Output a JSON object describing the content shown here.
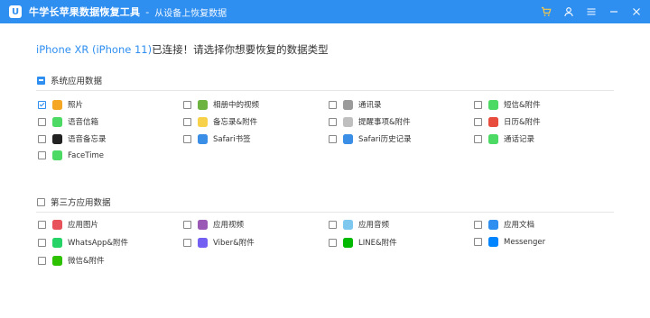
{
  "titlebar": {
    "app_name": "牛学长苹果数据恢复工具",
    "separator": "-",
    "breadcrumb": "从设备上恢复数据"
  },
  "headline": {
    "device": "iPhone XR (iPhone 11)",
    "text": "已连接！请选择你想要恢复的数据类型"
  },
  "system_section": {
    "label": "系统应用数据",
    "state": "partial",
    "items": [
      {
        "label": "照片",
        "checked": true,
        "icon": "photos-icon",
        "color": "#f5a623"
      },
      {
        "label": "相册中的视频",
        "checked": false,
        "icon": "video-album-icon",
        "color": "#6db33f"
      },
      {
        "label": "通讯录",
        "checked": false,
        "icon": "contacts-icon",
        "color": "#9b9b9b"
      },
      {
        "label": "短信&附件",
        "checked": false,
        "icon": "messages-icon",
        "color": "#4cd964"
      },
      {
        "label": "语音信箱",
        "checked": false,
        "icon": "voicemail-icon",
        "color": "#4cd964"
      },
      {
        "label": "备忘录&附件",
        "checked": false,
        "icon": "notes-icon",
        "color": "#f7d14a"
      },
      {
        "label": "提醒事项&附件",
        "checked": false,
        "icon": "reminders-icon",
        "color": "#bfbfbf"
      },
      {
        "label": "日历&附件",
        "checked": false,
        "icon": "calendar-icon",
        "color": "#e74c3c"
      },
      {
        "label": "语音备忘录",
        "checked": false,
        "icon": "voice-memos-icon",
        "color": "#222222"
      },
      {
        "label": "Safari书签",
        "checked": false,
        "icon": "safari-icon",
        "color": "#3a8ee6"
      },
      {
        "label": "Safari历史记录",
        "checked": false,
        "icon": "safari-history-icon",
        "color": "#3a8ee6"
      },
      {
        "label": "通话记录",
        "checked": false,
        "icon": "phone-icon",
        "color": "#4cd964"
      },
      {
        "label": "FaceTime",
        "checked": false,
        "icon": "facetime-icon",
        "color": "#4cd964"
      }
    ]
  },
  "third_party_section": {
    "label": "第三方应用数据",
    "state": "unchecked",
    "items": [
      {
        "label": "应用图片",
        "checked": false,
        "icon": "app-photos-icon",
        "color": "#e8525a"
      },
      {
        "label": "应用视频",
        "checked": false,
        "icon": "app-videos-icon",
        "color": "#9b59b6"
      },
      {
        "label": "应用音频",
        "checked": false,
        "icon": "app-audio-icon",
        "color": "#7ec8f0"
      },
      {
        "label": "应用文档",
        "checked": false,
        "icon": "app-documents-icon",
        "color": "#2f8ff0"
      },
      {
        "label": "WhatsApp&附件",
        "checked": false,
        "icon": "whatsapp-icon",
        "color": "#25d366"
      },
      {
        "label": "Viber&附件",
        "checked": false,
        "icon": "viber-icon",
        "color": "#7360f2"
      },
      {
        "label": "LINE&附件",
        "checked": false,
        "icon": "line-icon",
        "color": "#00b900"
      },
      {
        "label": "Messenger",
        "checked": false,
        "icon": "messenger-icon",
        "color": "#0084ff"
      },
      {
        "label": "微信&附件",
        "checked": false,
        "icon": "wechat-icon",
        "color": "#2dc100"
      }
    ]
  }
}
